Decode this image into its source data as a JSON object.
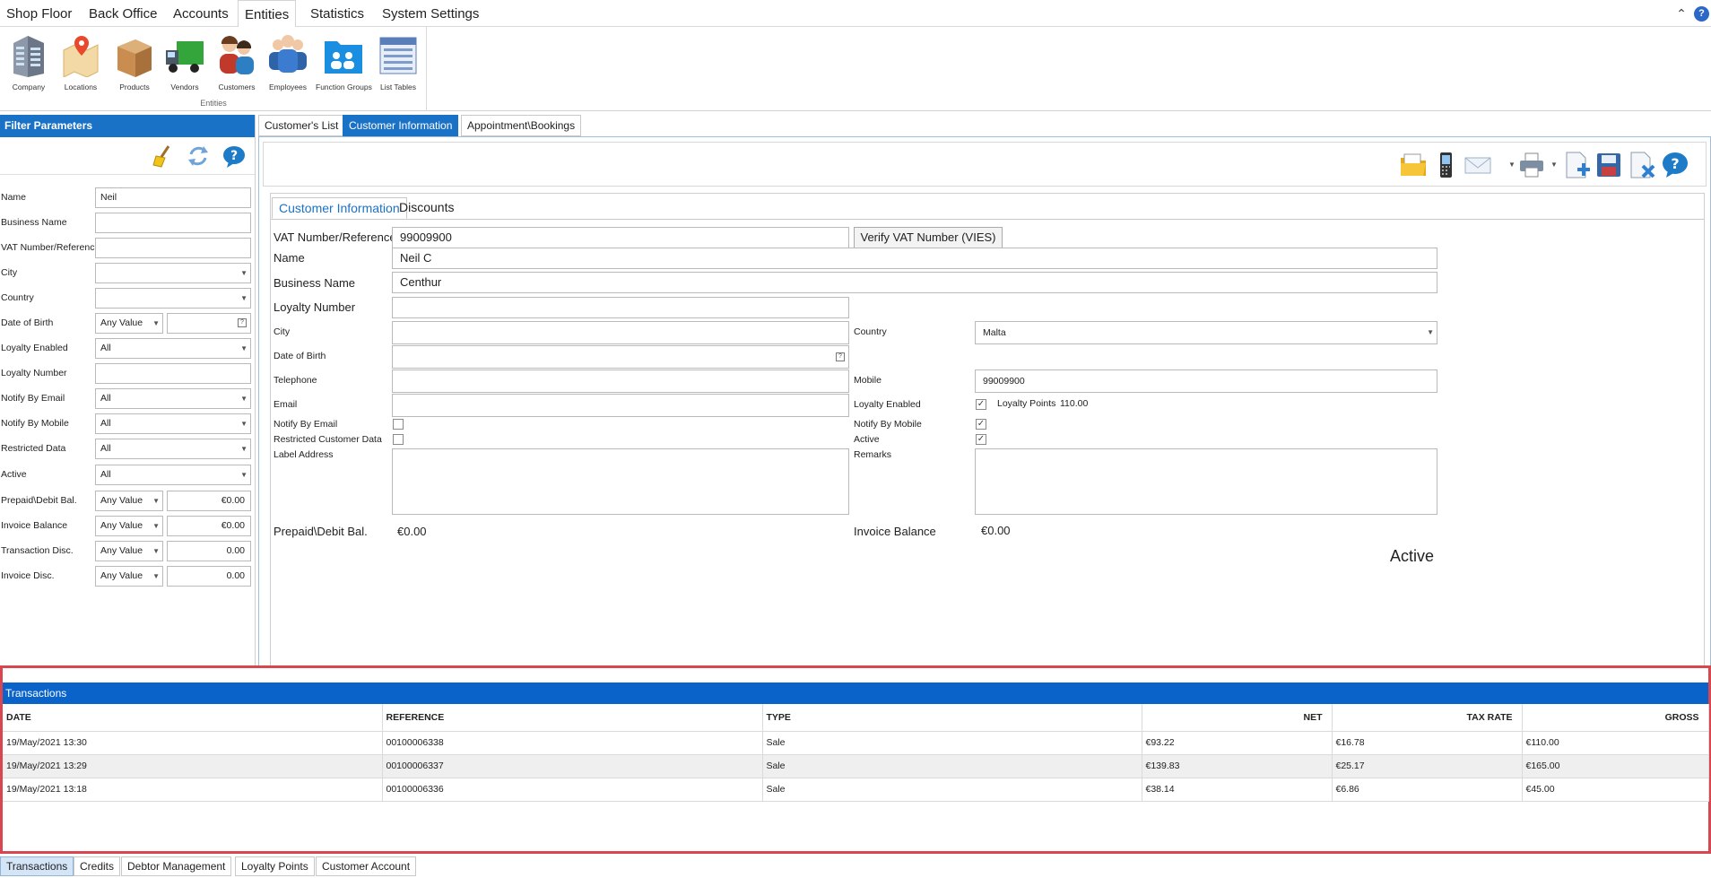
{
  "menu": {
    "tabs": [
      "Shop Floor",
      "Back Office",
      "Accounts",
      "Entities",
      "Statistics",
      "System Settings"
    ],
    "active": "Entities"
  },
  "ribbon": {
    "group_label": "Entities",
    "items": [
      {
        "label": "Company",
        "icon": "company-icon"
      },
      {
        "label": "Locations",
        "icon": "locations-icon"
      },
      {
        "label": "Products",
        "icon": "products-icon"
      },
      {
        "label": "Vendors",
        "icon": "vendors-icon"
      },
      {
        "label": "Customers",
        "icon": "customers-icon"
      },
      {
        "label": "Employees",
        "icon": "employees-icon"
      },
      {
        "label": "Function Groups",
        "icon": "function-groups-icon"
      },
      {
        "label": "List Tables",
        "icon": "list-tables-icon"
      }
    ]
  },
  "filter": {
    "title": "Filter Parameters",
    "fields": [
      {
        "label": "Name",
        "value": "Neil"
      },
      {
        "label": "Business Name",
        "value": ""
      },
      {
        "label": "VAT Number/Reference",
        "value": ""
      },
      {
        "label": "City",
        "value": ""
      },
      {
        "label": "Country",
        "value": ""
      },
      {
        "label": "Date of Birth",
        "op": "Any Value",
        "value": ""
      },
      {
        "label": "Loyalty Enabled",
        "value": "All"
      },
      {
        "label": "Loyalty Number",
        "value": ""
      },
      {
        "label": "Notify By Email",
        "value": "All"
      },
      {
        "label": "Notify By Mobile",
        "value": "All"
      },
      {
        "label": "Restricted Data",
        "value": "All"
      },
      {
        "label": "Active",
        "value": "All"
      },
      {
        "label": "Prepaid\\Debit Bal.",
        "op": "Any Value",
        "value": "€0.00"
      },
      {
        "label": "Invoice Balance",
        "op": "Any Value",
        "value": "€0.00"
      },
      {
        "label": "Transaction Disc.",
        "op": "Any Value",
        "value": "0.00"
      },
      {
        "label": "Invoice Disc.",
        "op": "Any Value",
        "value": "0.00"
      }
    ]
  },
  "main_tabs": [
    "Customer's List",
    "Customer Information",
    "Appointment\\Bookings"
  ],
  "main_tabs_active": "Customer Information",
  "inner_tabs": [
    "Customer Information",
    "Discounts"
  ],
  "form": {
    "vat_label": "VAT Number/Reference",
    "vat_value": "99009900",
    "verify_button": "Verify VAT Number (VIES)",
    "name_label": "Name",
    "name_value": "Neil C",
    "business_label": "Business Name",
    "business_value": "Centhur",
    "loyalty_number_label": "Loyalty Number",
    "loyalty_number_value": "",
    "city_label": "City",
    "city_value": "",
    "country_label": "Country",
    "country_value": "Malta",
    "dob_label": "Date of Birth",
    "dob_value": "",
    "telephone_label": "Telephone",
    "telephone_value": "",
    "mobile_label": "Mobile",
    "mobile_value": "99009900",
    "email_label": "Email",
    "email_value": "",
    "loyalty_enabled_label": "Loyalty Enabled",
    "loyalty_enabled": true,
    "loyalty_points_label": "Loyalty Points",
    "loyalty_points_value": "110.00",
    "notify_email_label": "Notify By Email",
    "notify_email": false,
    "notify_mobile_label": "Notify By Mobile",
    "notify_mobile": true,
    "restricted_label": "Restricted Customer Data",
    "restricted": false,
    "active_label": "Active",
    "active": true,
    "label_address_label": "Label Address",
    "remarks_label": "Remarks",
    "prepaid_label": "Prepaid\\Debit Bal.",
    "prepaid_value": "€0.00",
    "invoice_balance_label": "Invoice Balance",
    "invoice_balance_value": "€0.00",
    "status_text": "Active"
  },
  "transactions": {
    "title": "Transactions",
    "columns": [
      "DATE",
      "REFERENCE",
      "TYPE",
      "NET",
      "TAX RATE",
      "GROSS"
    ],
    "rows": [
      [
        "19/May/2021 13:30",
        "00100006338",
        "Sale",
        "€93.22",
        "€16.78",
        "€110.00"
      ],
      [
        "19/May/2021 13:29",
        "00100006337",
        "Sale",
        "€139.83",
        "€25.17",
        "€165.00"
      ],
      [
        "19/May/2021 13:18",
        "00100006336",
        "Sale",
        "€38.14",
        "€6.86",
        "€45.00"
      ]
    ]
  },
  "bottom_tabs": [
    "Transactions",
    "Credits",
    "Debtor Management",
    "Loyalty Points",
    "Customer Account"
  ],
  "bottom_tabs_active": "Transactions",
  "colors": {
    "accent_blue": "#1a72c7",
    "header_blue": "#0a63c9",
    "highlight_red": "#d9464f"
  }
}
